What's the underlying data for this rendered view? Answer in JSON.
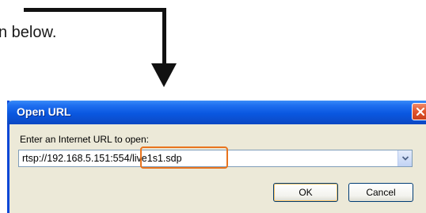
{
  "document": {
    "text": "n below."
  },
  "dialog": {
    "title": "Open URL",
    "prompt": "Enter an Internet URL to open:",
    "url_value": "rtsp://192.168.5.151:554/live1s1.sdp",
    "ok_label": "OK",
    "cancel_label": "Cancel"
  },
  "icons": {
    "close": "close-icon",
    "dropdown": "chevron-down-icon",
    "arrow": "down-arrow-icon"
  },
  "colors": {
    "title_bar": "#0a57e0",
    "close_button": "#e0542c",
    "highlight": "#e8741e",
    "dialog_bg": "#ece9d8"
  }
}
